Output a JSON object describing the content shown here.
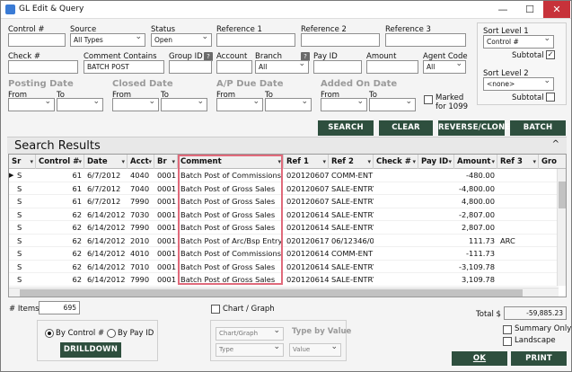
{
  "window": {
    "title": "GL Edit & Query",
    "min": "—",
    "max": "☐",
    "close": "✕"
  },
  "filters": {
    "control_label": "Control #",
    "source_label": "Source",
    "source_value": "All Types",
    "status_label": "Status",
    "status_value": "Open",
    "ref1_label": "Reference 1",
    "ref2_label": "Reference 2",
    "ref3_label": "Reference 3",
    "check_label": "Check #",
    "comment_contains_label": "Comment Contains",
    "comment_contains_value": "BATCH POST",
    "group_id_label": "Group ID",
    "account_label": "Account",
    "branch_label": "Branch",
    "branch_value": "All",
    "payid_label": "Pay ID",
    "amount_label": "Amount",
    "agent_code_label": "Agent Code",
    "agent_code_value": "All",
    "qmark": "?",
    "posting_date_label": "Posting Date",
    "closed_date_label": "Closed Date",
    "ap_due_date_label": "A/P Due Date",
    "added_on_date_label": "Added On Date",
    "from_label": "From",
    "to_label": "To",
    "marked_1099_label": "Marked for 1099"
  },
  "sort": {
    "level1_label": "Sort Level 1",
    "level1_value": "Control #",
    "subtotal1_label": "Subtotal",
    "subtotal1_checked": "✓",
    "level2_label": "Sort Level 2",
    "level2_value": "<none>",
    "subtotal2_label": "Subtotal"
  },
  "actions": {
    "search": "SEARCH",
    "clear": "CLEAR",
    "reverse_clone": "REVERSE/CLONE",
    "batch": "BATCH"
  },
  "results": {
    "title": "Search Results",
    "collapse": "^",
    "columns": [
      "Sr",
      "Control #",
      "Date",
      "Acct",
      "Br",
      "Comment",
      "Ref 1",
      "Ref 2",
      "Check #",
      "Pay ID",
      "Amount",
      "Ref 3",
      "Gro"
    ],
    "rows": [
      [
        "S",
        "61",
        "6/7/2012",
        "4040",
        "0001",
        "Batch Post of Commissions",
        "020120607",
        "COMM-ENT",
        "",
        "",
        "-480.00",
        ""
      ],
      [
        "S",
        "61",
        "6/7/2012",
        "7040",
        "0001",
        "Batch Post of Gross Sales",
        "020120607",
        "SALE-ENTRY",
        "",
        "",
        "-4,800.00",
        ""
      ],
      [
        "S",
        "61",
        "6/7/2012",
        "7990",
        "0001",
        "Batch Post of Gross Sales",
        "020120607",
        "SALE-ENTRY",
        "",
        "",
        "4,800.00",
        ""
      ],
      [
        "S",
        "62",
        "6/14/2012",
        "7030",
        "0001",
        "Batch Post of Gross Sales",
        "020120614",
        "SALE-ENTRY",
        "",
        "",
        "-2,807.00",
        ""
      ],
      [
        "S",
        "62",
        "6/14/2012",
        "7990",
        "0001",
        "Batch Post of Gross Sales",
        "020120614",
        "SALE-ENTRY",
        "",
        "",
        "2,807.00",
        ""
      ],
      [
        "S",
        "62",
        "6/14/2012",
        "2010",
        "0001",
        "Batch Post of Arc/Bsp Entry",
        "020120617",
        "06/12346/0",
        "",
        "",
        "111.73",
        "ARC"
      ],
      [
        "S",
        "62",
        "6/14/2012",
        "4010",
        "0001",
        "Batch Post of Commissions",
        "020120614",
        "COMM-ENT",
        "",
        "",
        "-111.73",
        ""
      ],
      [
        "S",
        "62",
        "6/14/2012",
        "7010",
        "0001",
        "Batch Post of Gross Sales",
        "020120614",
        "SALE-ENTRY",
        "",
        "",
        "-3,109.78",
        ""
      ],
      [
        "S",
        "62",
        "6/14/2012",
        "7990",
        "0001",
        "Batch Post of Gross Sales",
        "020120614",
        "SALE-ENTRY",
        "",
        "",
        "3,109.78",
        ""
      ]
    ]
  },
  "footer": {
    "items_label": "# Items",
    "items_value": "695",
    "chart_graph_label": "Chart / Graph",
    "type_by_value_label": "Type by Value",
    "chartgraph_sel": "Chart/Graph",
    "type_sel": "Type",
    "value_sel": "Value",
    "by_control_label": "By Control #",
    "by_payid_label": "By Pay ID",
    "drilldown": "DRILLDOWN",
    "total_label": "Total $",
    "total_value": "-59,885.23",
    "summary_only_label": "Summary Only",
    "landscape_label": "Landscape",
    "ok": "OK",
    "print": "PRINT"
  }
}
